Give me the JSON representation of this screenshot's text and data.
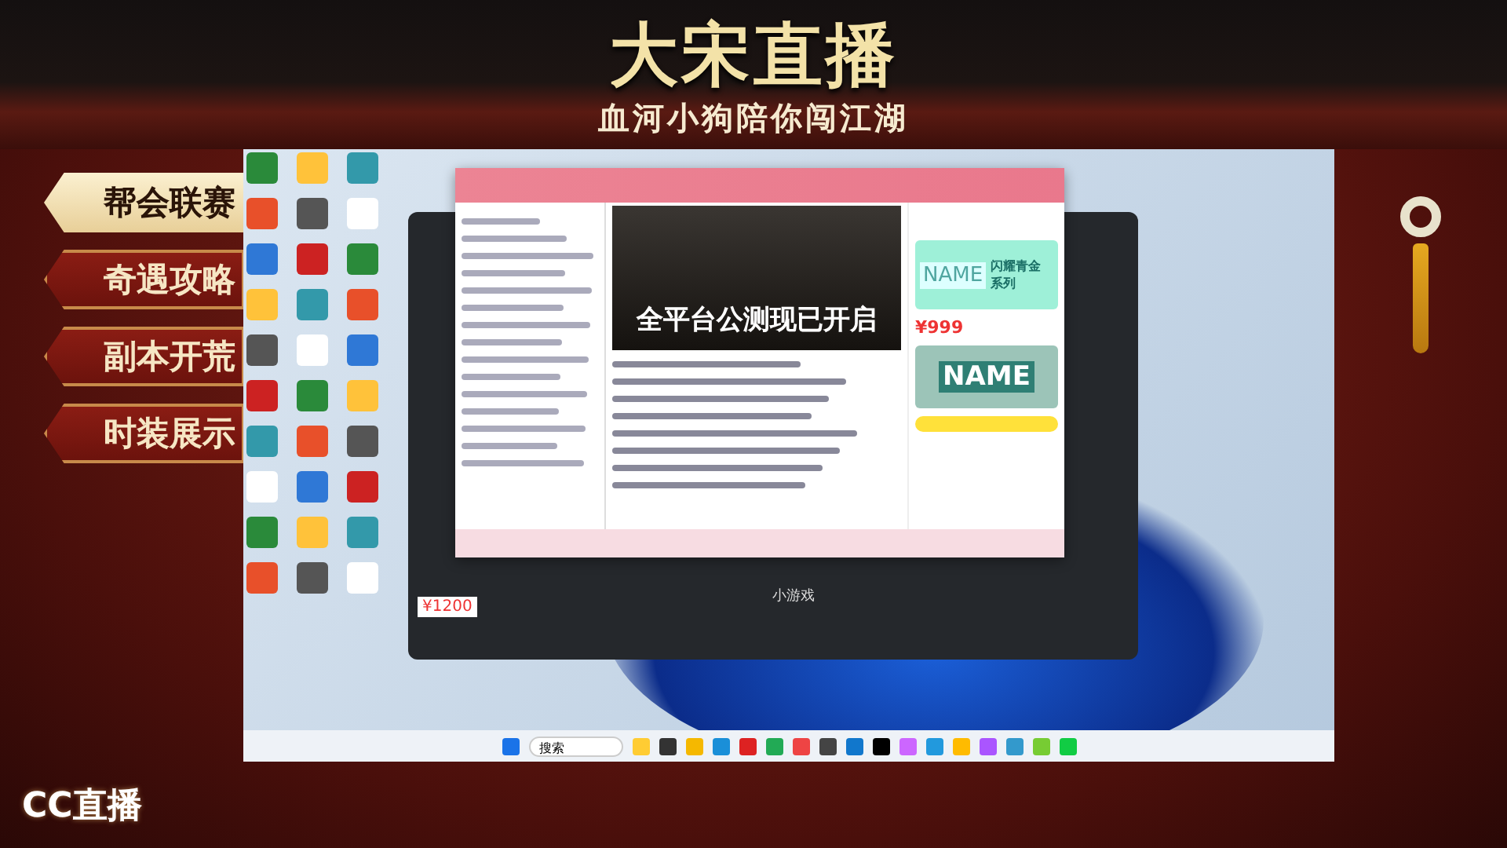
{
  "header": {
    "title": "大宋直播",
    "subtitle": "血河小狗陪你闯江湖"
  },
  "menu": [
    {
      "label": "帮会联赛",
      "selected": true
    },
    {
      "label": "奇遇攻略",
      "selected": false
    },
    {
      "label": "副本开荒",
      "selected": false
    },
    {
      "label": "时装展示",
      "selected": false
    }
  ],
  "desktop": {
    "chat_window": {
      "banner": {
        "text": "全平台公测现已开启"
      },
      "products": [
        {
          "art": "NAME",
          "title": "闪耀青金系列",
          "price": "¥999"
        },
        {
          "art": "NAME"
        }
      ]
    },
    "back_window": {
      "price": "¥1200",
      "label": "小游戏"
    },
    "taskbar": {
      "search": "搜索"
    }
  },
  "logo": {
    "text": "CC直播"
  }
}
